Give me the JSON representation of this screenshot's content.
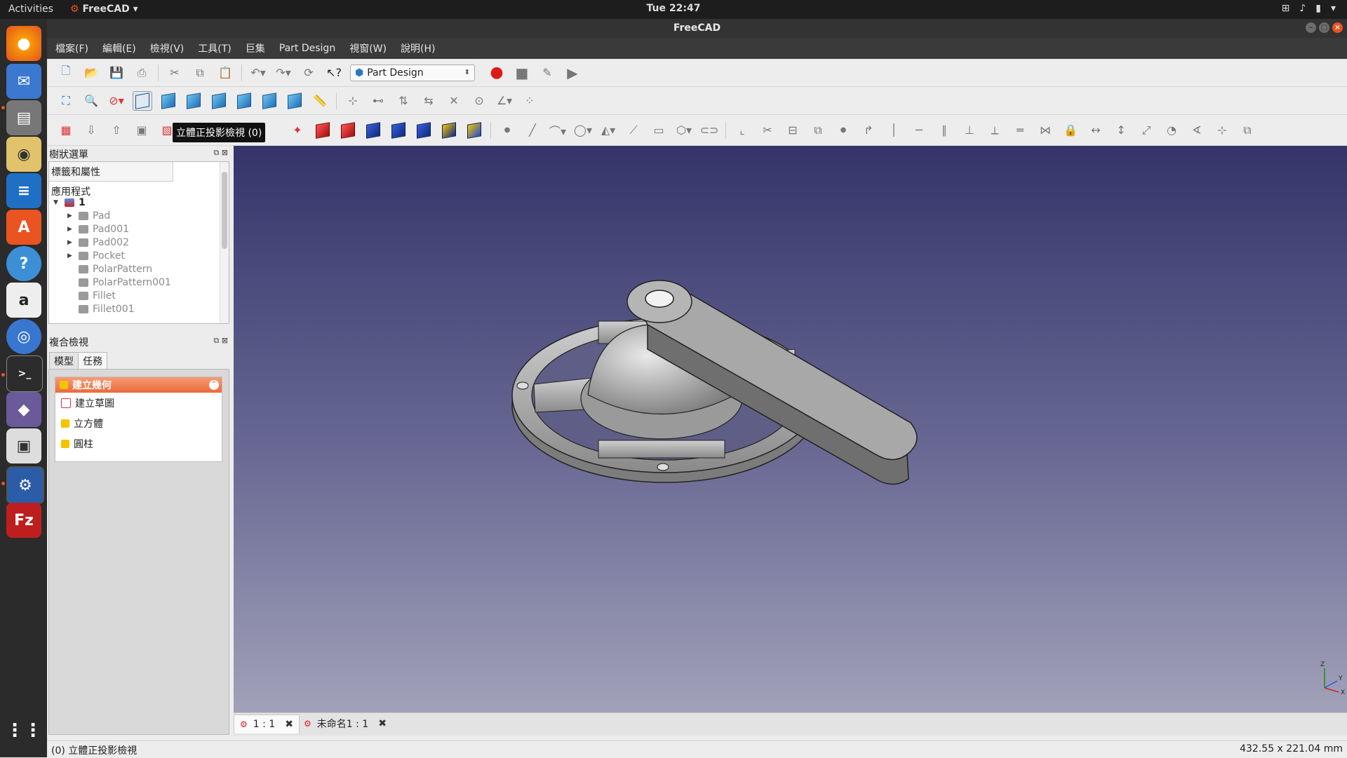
{
  "topbar": {
    "activities": "Activities",
    "app_name": "FreeCAD",
    "clock": "Tue 22:47"
  },
  "window": {
    "title": "FreeCAD"
  },
  "menu": [
    "檔案(F)",
    "編輯(E)",
    "檢視(V)",
    "工具(T)",
    "巨集",
    "Part Design",
    "視窗(W)",
    "說明(H)"
  ],
  "toolbar": {
    "workbench": "Part Design",
    "tooltip": "立體正投影檢視 (0)"
  },
  "tree": {
    "title": "樹狀選單",
    "column_header": "標籤和屬性",
    "section": "應用程式",
    "root": "1",
    "items": [
      {
        "label": "Pad",
        "expandable": true
      },
      {
        "label": "Pad001",
        "expandable": true
      },
      {
        "label": "Pad002",
        "expandable": true
      },
      {
        "label": "Pocket",
        "expandable": true
      },
      {
        "label": "PolarPattern",
        "expandable": false
      },
      {
        "label": "PolarPattern001",
        "expandable": false
      },
      {
        "label": "Fillet",
        "expandable": false
      },
      {
        "label": "Fillet001",
        "expandable": false
      }
    ]
  },
  "combo": {
    "title": "複合檢視",
    "tabs": [
      "模型",
      "任務"
    ],
    "active_tab": 1,
    "task_header": "建立幾何",
    "tasks": [
      "建立草圖",
      "立方體",
      "圓柱"
    ]
  },
  "doc_tabs": [
    {
      "label": "1 : 1",
      "active": true
    },
    {
      "label": "未命名1 : 1",
      "active": false
    }
  ],
  "axis": {
    "z": "Z",
    "y": "Y",
    "x": "X"
  },
  "status": {
    "message": "(0) 立體正投影檢視",
    "dimensions": "432.55 x 221.04 mm"
  },
  "colors": {
    "accent": "#e95420",
    "task_header": "#ec6a3d",
    "view_top": "#34346a",
    "view_bottom": "#a1a1b9"
  }
}
